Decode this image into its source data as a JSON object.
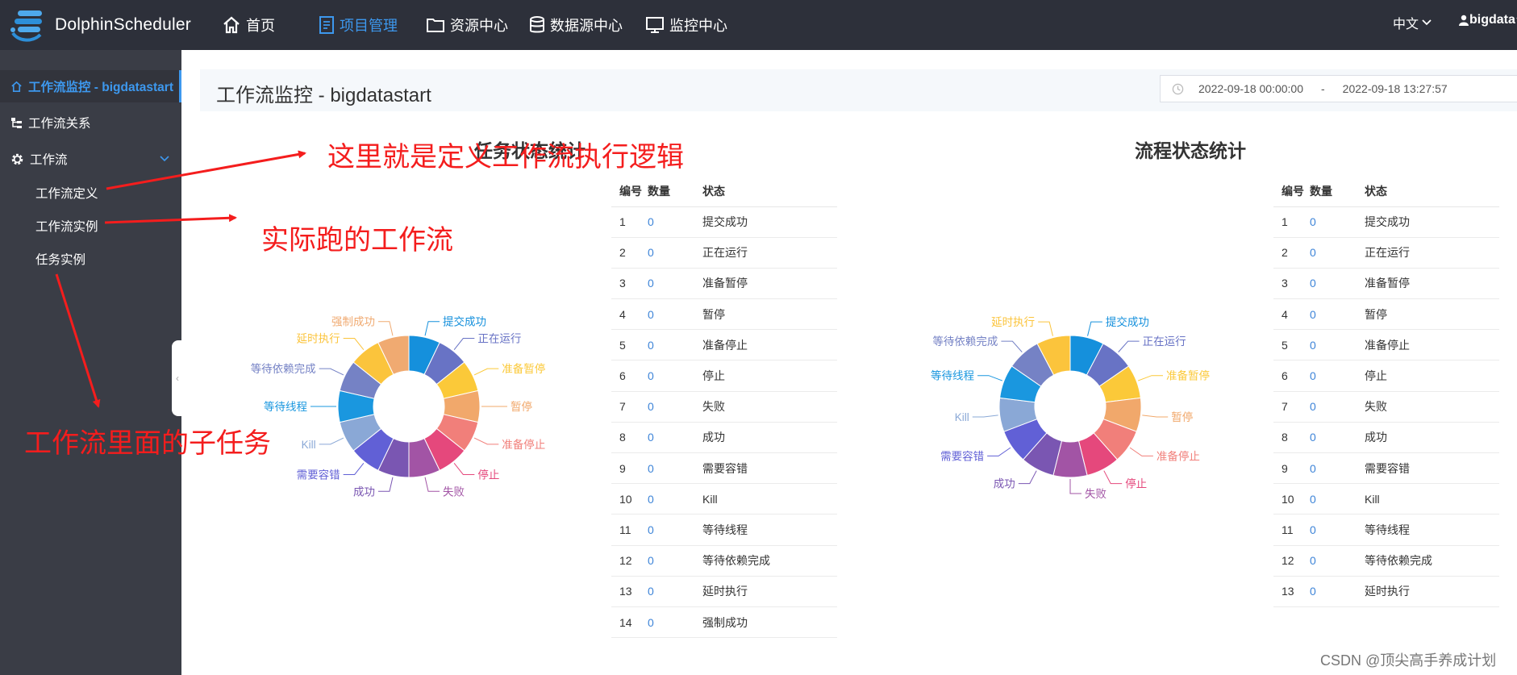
{
  "app": {
    "name": "DolphinScheduler"
  },
  "nav": {
    "items": [
      {
        "label": "首页",
        "icon": "home-icon"
      },
      {
        "label": "项目管理",
        "icon": "document-icon",
        "active": true
      },
      {
        "label": "资源中心",
        "icon": "folder-icon"
      },
      {
        "label": "数据源中心",
        "icon": "database-icon"
      },
      {
        "label": "监控中心",
        "icon": "monitor-icon"
      }
    ],
    "language": "中文",
    "user": "bigdata"
  },
  "sidebar": {
    "items": [
      {
        "label": "工作流监控 - bigdatastart",
        "icon": "home-icon",
        "active": true
      },
      {
        "label": "工作流关系",
        "icon": "tree-icon"
      },
      {
        "label": "工作流",
        "icon": "gear-icon"
      }
    ],
    "subitems": [
      {
        "label": "工作流定义"
      },
      {
        "label": "工作流实例"
      },
      {
        "label": "任务实例"
      }
    ]
  },
  "page": {
    "title": "工作流监控 - bigdatastart",
    "date_start": "2022-09-18 00:00:00",
    "date_sep": "-",
    "date_end": "2022-09-18 13:27:57"
  },
  "task_stats": {
    "title": "任务状态统计",
    "headers": [
      "编号",
      "数量",
      "状态"
    ],
    "rows": [
      {
        "id": "1",
        "count": "0",
        "state": "提交成功"
      },
      {
        "id": "2",
        "count": "0",
        "state": "正在运行"
      },
      {
        "id": "3",
        "count": "0",
        "state": "准备暂停"
      },
      {
        "id": "4",
        "count": "0",
        "state": "暂停"
      },
      {
        "id": "5",
        "count": "0",
        "state": "准备停止"
      },
      {
        "id": "6",
        "count": "0",
        "state": "停止"
      },
      {
        "id": "7",
        "count": "0",
        "state": "失败"
      },
      {
        "id": "8",
        "count": "0",
        "state": "成功"
      },
      {
        "id": "9",
        "count": "0",
        "state": "需要容错"
      },
      {
        "id": "10",
        "count": "0",
        "state": "Kill"
      },
      {
        "id": "11",
        "count": "0",
        "state": "等待线程"
      },
      {
        "id": "12",
        "count": "0",
        "state": "等待依赖完成"
      },
      {
        "id": "13",
        "count": "0",
        "state": "延时执行"
      },
      {
        "id": "14",
        "count": "0",
        "state": "强制成功"
      }
    ]
  },
  "process_stats": {
    "title": "流程状态统计",
    "headers": [
      "编号",
      "数量",
      "状态"
    ],
    "rows": [
      {
        "id": "1",
        "count": "0",
        "state": "提交成功"
      },
      {
        "id": "2",
        "count": "0",
        "state": "正在运行"
      },
      {
        "id": "3",
        "count": "0",
        "state": "准备暂停"
      },
      {
        "id": "4",
        "count": "0",
        "state": "暂停"
      },
      {
        "id": "5",
        "count": "0",
        "state": "准备停止"
      },
      {
        "id": "6",
        "count": "0",
        "state": "停止"
      },
      {
        "id": "7",
        "count": "0",
        "state": "失败"
      },
      {
        "id": "8",
        "count": "0",
        "state": "成功"
      },
      {
        "id": "9",
        "count": "0",
        "state": "需要容错"
      },
      {
        "id": "10",
        "count": "0",
        "state": "Kill"
      },
      {
        "id": "11",
        "count": "0",
        "state": "等待线程"
      },
      {
        "id": "12",
        "count": "0",
        "state": "等待依赖完成"
      },
      {
        "id": "13",
        "count": "0",
        "state": "延时执行"
      }
    ]
  },
  "chart_data": [
    {
      "type": "pie",
      "title": "任务状态统计",
      "donut": true,
      "categories": [
        "提交成功",
        "正在运行",
        "准备暂停",
        "暂停",
        "准备停止",
        "停止",
        "失败",
        "成功",
        "需要容错",
        "Kill",
        "等待线程",
        "等待依赖完成",
        "延时执行",
        "强制成功"
      ],
      "values": [
        0,
        0,
        0,
        0,
        0,
        0,
        0,
        0,
        0,
        0,
        0,
        0,
        0,
        0
      ],
      "colors": [
        "#1590dc",
        "#6873c5",
        "#fbc939",
        "#f1a86b",
        "#f17f7a",
        "#e5487c",
        "#a254a5",
        "#7a56b2",
        "#6160d6",
        "#8aa8d6",
        "#1a97df",
        "#7582c5",
        "#fbc43c",
        "#f0aa71"
      ]
    },
    {
      "type": "pie",
      "title": "流程状态统计",
      "donut": true,
      "categories": [
        "提交成功",
        "正在运行",
        "准备暂停",
        "暂停",
        "准备停止",
        "停止",
        "失败",
        "成功",
        "需要容错",
        "Kill",
        "等待线程",
        "等待依赖完成",
        "延时执行"
      ],
      "values": [
        0,
        0,
        0,
        0,
        0,
        0,
        0,
        0,
        0,
        0,
        0,
        0,
        0
      ],
      "colors": [
        "#1590dc",
        "#6873c5",
        "#fbc939",
        "#f1a86b",
        "#f17f7a",
        "#e5487c",
        "#a254a5",
        "#7a56b2",
        "#6160d6",
        "#8aa8d6",
        "#1a97df",
        "#7582c5",
        "#fbc43c"
      ]
    }
  ],
  "annotations": {
    "a1": "这里就是定义工作流执行逻辑",
    "a2": "实际跑的工作流",
    "a3": "工作流里面的子任务"
  },
  "watermark": "CSDN @顶尖高手养成计划"
}
